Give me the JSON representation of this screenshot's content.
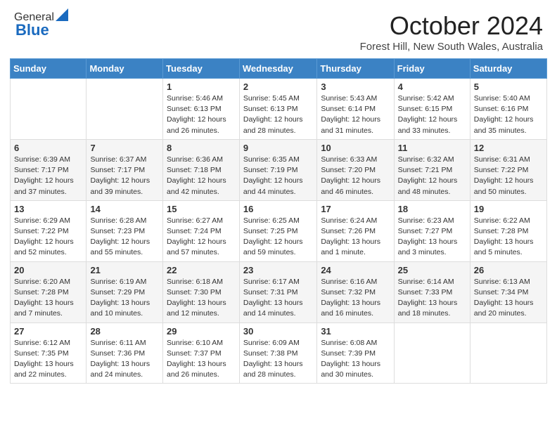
{
  "header": {
    "logo_line1": "General",
    "logo_line2": "Blue",
    "month_title": "October 2024",
    "location": "Forest Hill, New South Wales, Australia"
  },
  "days_of_week": [
    "Sunday",
    "Monday",
    "Tuesday",
    "Wednesday",
    "Thursday",
    "Friday",
    "Saturday"
  ],
  "weeks": [
    [
      {
        "day": "",
        "info": ""
      },
      {
        "day": "",
        "info": ""
      },
      {
        "day": "1",
        "info": "Sunrise: 5:46 AM\nSunset: 6:13 PM\nDaylight: 12 hours and 26 minutes."
      },
      {
        "day": "2",
        "info": "Sunrise: 5:45 AM\nSunset: 6:13 PM\nDaylight: 12 hours and 28 minutes."
      },
      {
        "day": "3",
        "info": "Sunrise: 5:43 AM\nSunset: 6:14 PM\nDaylight: 12 hours and 31 minutes."
      },
      {
        "day": "4",
        "info": "Sunrise: 5:42 AM\nSunset: 6:15 PM\nDaylight: 12 hours and 33 minutes."
      },
      {
        "day": "5",
        "info": "Sunrise: 5:40 AM\nSunset: 6:16 PM\nDaylight: 12 hours and 35 minutes."
      }
    ],
    [
      {
        "day": "6",
        "info": "Sunrise: 6:39 AM\nSunset: 7:17 PM\nDaylight: 12 hours and 37 minutes."
      },
      {
        "day": "7",
        "info": "Sunrise: 6:37 AM\nSunset: 7:17 PM\nDaylight: 12 hours and 39 minutes."
      },
      {
        "day": "8",
        "info": "Sunrise: 6:36 AM\nSunset: 7:18 PM\nDaylight: 12 hours and 42 minutes."
      },
      {
        "day": "9",
        "info": "Sunrise: 6:35 AM\nSunset: 7:19 PM\nDaylight: 12 hours and 44 minutes."
      },
      {
        "day": "10",
        "info": "Sunrise: 6:33 AM\nSunset: 7:20 PM\nDaylight: 12 hours and 46 minutes."
      },
      {
        "day": "11",
        "info": "Sunrise: 6:32 AM\nSunset: 7:21 PM\nDaylight: 12 hours and 48 minutes."
      },
      {
        "day": "12",
        "info": "Sunrise: 6:31 AM\nSunset: 7:22 PM\nDaylight: 12 hours and 50 minutes."
      }
    ],
    [
      {
        "day": "13",
        "info": "Sunrise: 6:29 AM\nSunset: 7:22 PM\nDaylight: 12 hours and 52 minutes."
      },
      {
        "day": "14",
        "info": "Sunrise: 6:28 AM\nSunset: 7:23 PM\nDaylight: 12 hours and 55 minutes."
      },
      {
        "day": "15",
        "info": "Sunrise: 6:27 AM\nSunset: 7:24 PM\nDaylight: 12 hours and 57 minutes."
      },
      {
        "day": "16",
        "info": "Sunrise: 6:25 AM\nSunset: 7:25 PM\nDaylight: 12 hours and 59 minutes."
      },
      {
        "day": "17",
        "info": "Sunrise: 6:24 AM\nSunset: 7:26 PM\nDaylight: 13 hours and 1 minute."
      },
      {
        "day": "18",
        "info": "Sunrise: 6:23 AM\nSunset: 7:27 PM\nDaylight: 13 hours and 3 minutes."
      },
      {
        "day": "19",
        "info": "Sunrise: 6:22 AM\nSunset: 7:28 PM\nDaylight: 13 hours and 5 minutes."
      }
    ],
    [
      {
        "day": "20",
        "info": "Sunrise: 6:20 AM\nSunset: 7:28 PM\nDaylight: 13 hours and 7 minutes."
      },
      {
        "day": "21",
        "info": "Sunrise: 6:19 AM\nSunset: 7:29 PM\nDaylight: 13 hours and 10 minutes."
      },
      {
        "day": "22",
        "info": "Sunrise: 6:18 AM\nSunset: 7:30 PM\nDaylight: 13 hours and 12 minutes."
      },
      {
        "day": "23",
        "info": "Sunrise: 6:17 AM\nSunset: 7:31 PM\nDaylight: 13 hours and 14 minutes."
      },
      {
        "day": "24",
        "info": "Sunrise: 6:16 AM\nSunset: 7:32 PM\nDaylight: 13 hours and 16 minutes."
      },
      {
        "day": "25",
        "info": "Sunrise: 6:14 AM\nSunset: 7:33 PM\nDaylight: 13 hours and 18 minutes."
      },
      {
        "day": "26",
        "info": "Sunrise: 6:13 AM\nSunset: 7:34 PM\nDaylight: 13 hours and 20 minutes."
      }
    ],
    [
      {
        "day": "27",
        "info": "Sunrise: 6:12 AM\nSunset: 7:35 PM\nDaylight: 13 hours and 22 minutes."
      },
      {
        "day": "28",
        "info": "Sunrise: 6:11 AM\nSunset: 7:36 PM\nDaylight: 13 hours and 24 minutes."
      },
      {
        "day": "29",
        "info": "Sunrise: 6:10 AM\nSunset: 7:37 PM\nDaylight: 13 hours and 26 minutes."
      },
      {
        "day": "30",
        "info": "Sunrise: 6:09 AM\nSunset: 7:38 PM\nDaylight: 13 hours and 28 minutes."
      },
      {
        "day": "31",
        "info": "Sunrise: 6:08 AM\nSunset: 7:39 PM\nDaylight: 13 hours and 30 minutes."
      },
      {
        "day": "",
        "info": ""
      },
      {
        "day": "",
        "info": ""
      }
    ]
  ]
}
